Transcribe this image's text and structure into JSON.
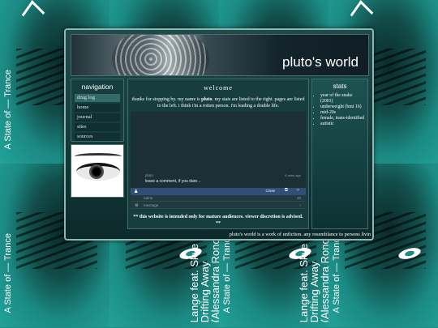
{
  "background": {
    "tile_text": "A State of — Trance",
    "artist_text": "Lange feat. Skye\nDrifting Away\n(Alessandra Ronc",
    "accent_color": "#22a39a"
  },
  "header": {
    "title": "pluto's world"
  },
  "nav": {
    "heading": "navigation",
    "items": [
      {
        "label": "drug log"
      },
      {
        "label": "home"
      },
      {
        "label": "journal"
      },
      {
        "label": "sites"
      },
      {
        "label": "sources"
      }
    ]
  },
  "main": {
    "heading": "welcome",
    "intro_a": "thanks for stopping by. my name is ",
    "intro_name": "pluto",
    "intro_b": ". my stats are listed to the right. pages are listed to the left. i think i'm a rotten person. i'm leading a double life.",
    "warning": "** this website is intended only for mature audiences. viewer discretion is advised. **"
  },
  "comments": {
    "username": "pluto",
    "comment": "leave a comment, if you dare...",
    "time": "6 mins ago",
    "close_label": "Close",
    "name_placeholder": "name",
    "message_placeholder": "message",
    "name_counter": "40"
  },
  "stats": {
    "heading": "stats",
    "items": [
      "year of the snake (2001)",
      "underweight (bmi 16)",
      "mid-20s",
      "female, trans-identified",
      "autistic"
    ]
  },
  "footer": {
    "text": "pluto's world is a work of unfiction. any resemblance to persons livin"
  }
}
